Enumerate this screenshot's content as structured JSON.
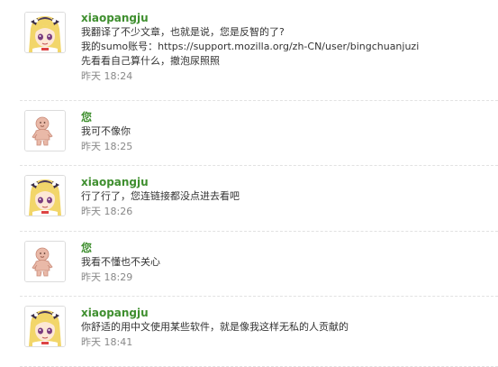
{
  "messages": [
    {
      "author": "xiaopangju",
      "avatar": "anime-girl-avatar-icon",
      "lines": [
        "我翻译了不少文章，也就是说，您是反智的了?",
        "我的sumo账号：https://support.mozilla.org/zh-CN/user/bingchuanjuzi",
        "先看看自己算什么，撤泡尿照照"
      ],
      "time": "昨天 18:24"
    },
    {
      "author": "您",
      "avatar": "default-user-avatar-icon",
      "lines": [
        "我可不像你"
      ],
      "time": "昨天 18:25"
    },
    {
      "author": "xiaopangju",
      "avatar": "anime-girl-avatar-icon",
      "lines": [
        "行了行了，您连链接都没点进去看吧"
      ],
      "time": "昨天 18:26"
    },
    {
      "author": "您",
      "avatar": "default-user-avatar-icon",
      "lines": [
        "我看不懂也不关心"
      ],
      "time": "昨天 18:29"
    },
    {
      "author": "xiaopangju",
      "avatar": "anime-girl-avatar-icon",
      "lines": [
        "你舒适的用中文使用某些软件，就是像我这样无私的人贡献的"
      ],
      "time": "昨天 18:41"
    }
  ],
  "colors": {
    "author": "#3f8f2f",
    "text": "#333333",
    "time": "#888888",
    "divider": "#e2e2e2"
  }
}
